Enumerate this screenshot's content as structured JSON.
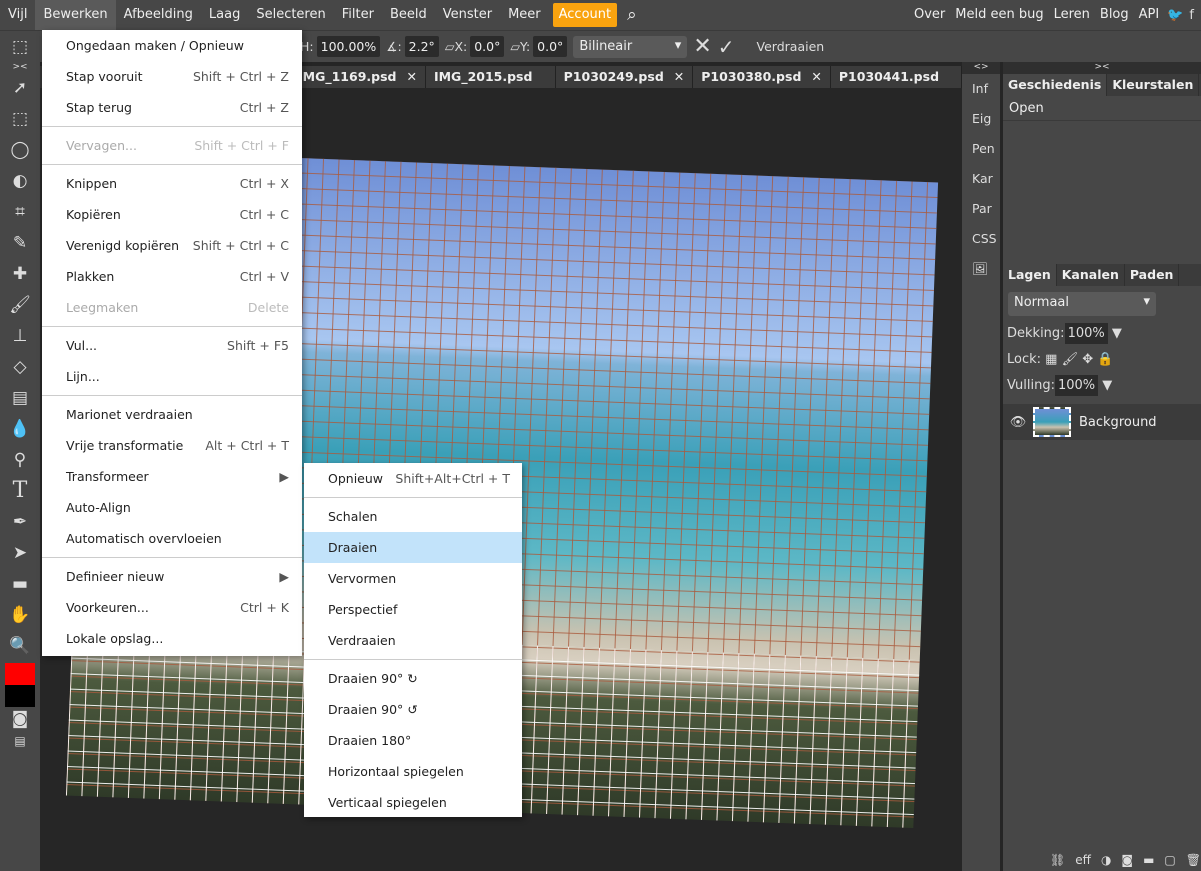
{
  "menubar": {
    "items": [
      "Vijl",
      "Bewerken",
      "Afbeelding",
      "Laag",
      "Selecteren",
      "Filter",
      "Beeld",
      "Venster",
      "Meer",
      "Account"
    ],
    "right": [
      "Over",
      "Meld een bug",
      "Leren",
      "Blog",
      "API"
    ]
  },
  "options": {
    "h_label": "H:",
    "h": "100.00%",
    "angle_label": "∡:",
    "angle": "2.2°",
    "skew_x_label": "X:",
    "skew_x": "0.0°",
    "skew_y_label": "Y:",
    "skew_y": "0.0°",
    "interp": "Bilineair",
    "warp": "Verdraaien"
  },
  "tabs": [
    {
      "label": "IMG_1169.psd"
    },
    {
      "label": "IMG_2015.psd *"
    },
    {
      "label": "P1030249.psd"
    },
    {
      "label": "P1030380.psd"
    },
    {
      "label": "P1030441.psd *"
    }
  ],
  "edit_menu": [
    {
      "label": "Ongedaan maken / Opnieuw",
      "key": ""
    },
    {
      "label": "Stap vooruit",
      "key": "Shift + Ctrl + Z"
    },
    {
      "label": "Stap terug",
      "key": "Ctrl + Z",
      "sep": true
    },
    {
      "label": "Vervagen...",
      "key": "Shift + Ctrl + F",
      "disabled": true,
      "sep": true
    },
    {
      "label": "Knippen",
      "key": "Ctrl + X"
    },
    {
      "label": "Kopiëren",
      "key": "Ctrl + C"
    },
    {
      "label": "Verenigd kopiëren",
      "key": "Shift + Ctrl + C"
    },
    {
      "label": "Plakken",
      "key": "Ctrl + V"
    },
    {
      "label": "Leegmaken",
      "key": "Delete",
      "disabled": true,
      "sep": true
    },
    {
      "label": "Vul...",
      "key": "Shift + F5"
    },
    {
      "label": "Lijn...",
      "key": "",
      "sep": true
    },
    {
      "label": "Marionet verdraaien",
      "key": ""
    },
    {
      "label": "Vrije transformatie",
      "key": "Alt + Ctrl + T"
    },
    {
      "label": "Transformeer",
      "key": "▶"
    },
    {
      "label": "Auto-Align",
      "key": ""
    },
    {
      "label": "Automatisch overvloeien",
      "key": "",
      "sep": true
    },
    {
      "label": "Definieer nieuw",
      "key": "▶"
    },
    {
      "label": "Voorkeuren...",
      "key": "Ctrl + K"
    },
    {
      "label": "Lokale opslag...",
      "key": ""
    }
  ],
  "transform_menu": [
    {
      "label": "Opnieuw",
      "key": "Shift+Alt+Ctrl + T",
      "sep": true
    },
    {
      "label": "Schalen",
      "key": ""
    },
    {
      "label": "Draaien",
      "key": "",
      "highlight": true
    },
    {
      "label": "Vervormen",
      "key": ""
    },
    {
      "label": "Perspectief",
      "key": ""
    },
    {
      "label": "Verdraaien",
      "key": "",
      "sep": true
    },
    {
      "label": "Draaien 90° ↻",
      "key": ""
    },
    {
      "label": "Draaien 90° ↺",
      "key": ""
    },
    {
      "label": "Draaien 180°",
      "key": ""
    },
    {
      "label": "Horizontaal spiegelen",
      "key": ""
    },
    {
      "label": "Verticaal spiegelen",
      "key": ""
    }
  ],
  "side_narrow": [
    "Inf",
    "Eig",
    "Pen",
    "Kar",
    "Par",
    "CSS"
  ],
  "history": {
    "tabs": [
      "Geschiedenis",
      "Kleurstalen"
    ],
    "items": [
      "Open"
    ]
  },
  "layers": {
    "tabs": [
      "Lagen",
      "Kanalen",
      "Paden"
    ],
    "blend": "Normaal",
    "opacity_label": "Dekking:",
    "opacity": "100%",
    "lock_label": "Lock:",
    "fill_label": "Vulling:",
    "fill": "100%",
    "items": [
      {
        "name": "Background"
      }
    ],
    "footer": "eff"
  },
  "colors": {
    "accent": "#f9a30f",
    "foreground": "#ff0000",
    "background": "#000000",
    "highlight": "#c2e3fa"
  }
}
